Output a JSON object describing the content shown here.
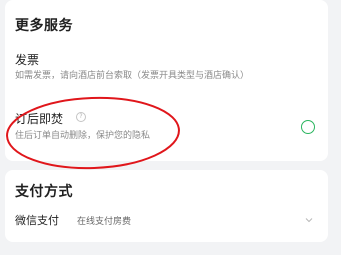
{
  "more_services": {
    "title": "更多服务",
    "invoice": {
      "label": "发票",
      "description": "如需发票，请向酒店前台索取（发票开具类型与酒店确认）"
    },
    "delete_after_stay": {
      "label": "订后即焚",
      "help_icon": "question-circle-icon",
      "description": "住后订单自动删除，保护您的隐私",
      "toggle_selected": false
    }
  },
  "payment": {
    "title": "支付方式",
    "method": "微信支付",
    "note": "在线支付房费",
    "expand_icon": "chevron-down-icon"
  },
  "colors": {
    "background": "#f2f3f5",
    "card": "#ffffff",
    "toggle_border": "#2bb55f",
    "annotation": "#e0161b"
  }
}
